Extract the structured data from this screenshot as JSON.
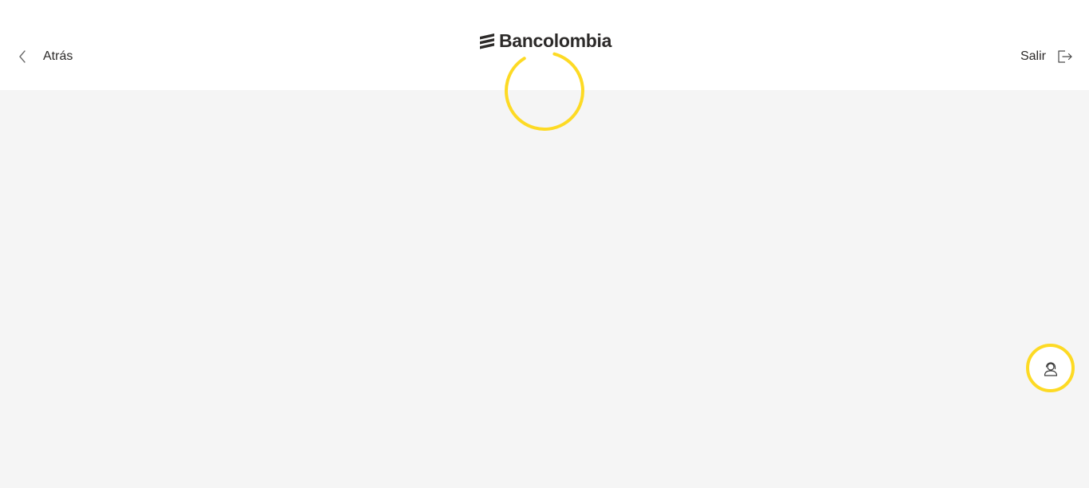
{
  "header": {
    "back_label": "Atrás",
    "brand": "Bancolombia",
    "exit_label": "Salir"
  },
  "icons": {
    "back": "chevron-left-icon",
    "brand_mark": "bancolombia-logo-icon",
    "exit": "logout-icon",
    "loading": "loading-spinner",
    "help": "advisor-headset-icon"
  },
  "colors": {
    "accent": "#fdda24",
    "text": "#2c2a29",
    "header_bg": "#ffffff",
    "page_bg": "#f5f5f5"
  },
  "status": {
    "loading": true
  }
}
